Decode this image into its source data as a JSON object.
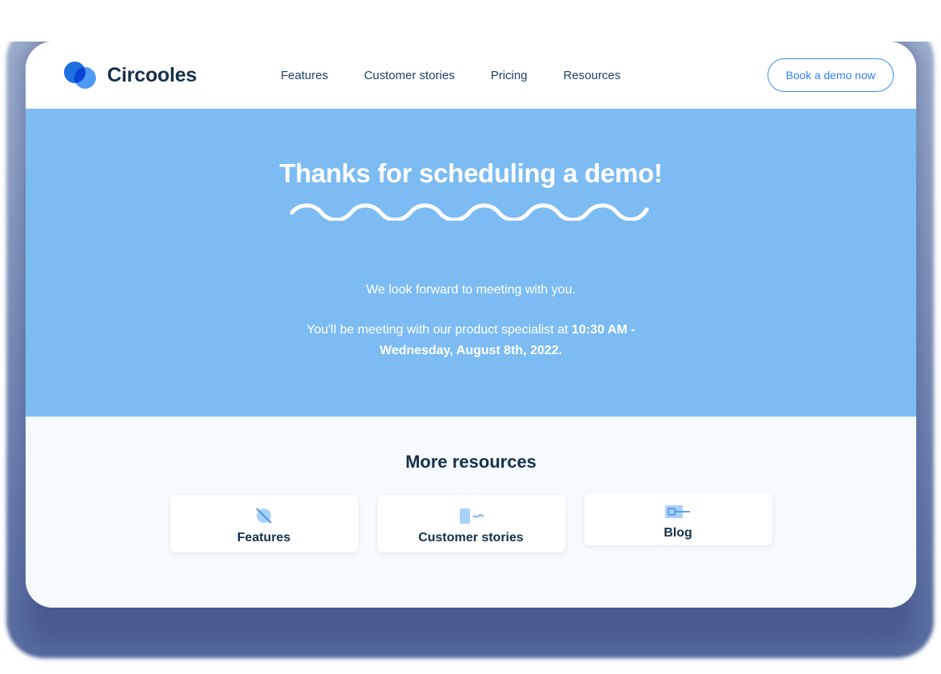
{
  "header": {
    "brand_name": "Circooles",
    "logo_icon": "two-overlapping-circles-logo",
    "nav": [
      {
        "label": "Features"
      },
      {
        "label": "Customer stories"
      },
      {
        "label": "Pricing"
      },
      {
        "label": "Resources"
      }
    ],
    "cta_label": "Book a demo now"
  },
  "hero": {
    "title": "Thanks for scheduling a demo!",
    "divider_icon": "wavy-squiggle-divider",
    "lead": "We look forward to meeting with you.",
    "detail_prefix": "You'll be meeting with our product specialist at ",
    "detail_time": "10:30 AM - Wednesday, August 8th, 2022."
  },
  "resources": {
    "title": "More resources",
    "cards": [
      {
        "label": "Features",
        "icon": "planet-circle-slash-icon"
      },
      {
        "label": "Customer stories",
        "icon": "document-squiggle-icon"
      },
      {
        "label": "Blog",
        "icon": "window-panel-icon"
      }
    ]
  },
  "colors": {
    "hero_background": "#7cbcf2",
    "resources_background": "#f5fafd",
    "brand_dark": "#16304b",
    "accent_blue": "#2f7fee",
    "logo_dark": "#1f6fe0",
    "logo_light": "#4e9bf5",
    "icon_light": "#a9d2fa",
    "icon_stroke": "#4e9bf5"
  }
}
